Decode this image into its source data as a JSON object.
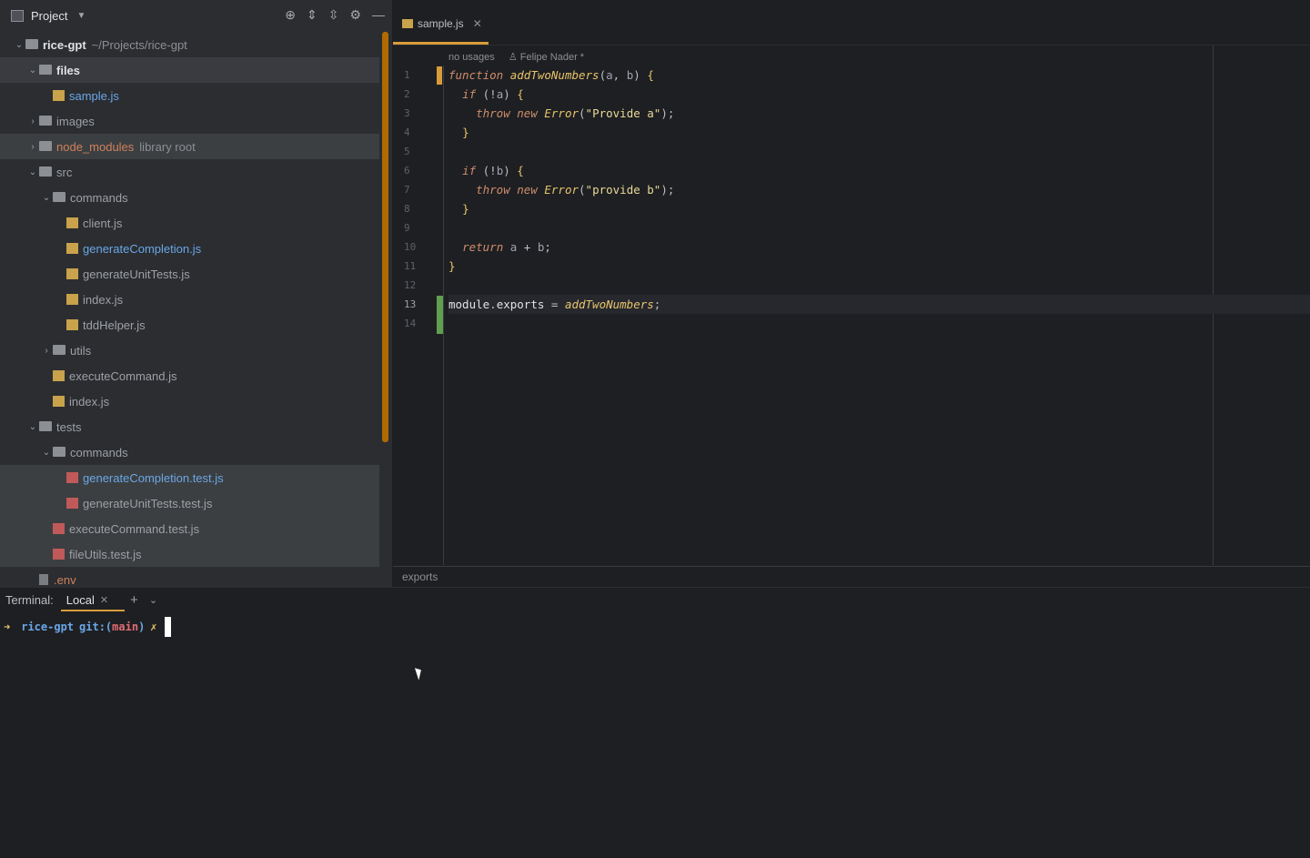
{
  "project_panel": {
    "title": "Project",
    "tree": [
      {
        "label": "rice-gpt",
        "extra": "~/Projects/rice-gpt",
        "type": "folder",
        "depth": 0,
        "open": true
      },
      {
        "label": "files",
        "type": "folder",
        "depth": 1,
        "open": true
      },
      {
        "label": "sample.js",
        "type": "js",
        "depth": 2
      },
      {
        "label": "images",
        "type": "folder",
        "depth": 1,
        "open": false
      },
      {
        "label": "node_modules",
        "extra": "library root",
        "type": "folder",
        "depth": 1,
        "open": false
      },
      {
        "label": "src",
        "type": "folder",
        "depth": 1,
        "open": true
      },
      {
        "label": "commands",
        "type": "folder",
        "depth": 2,
        "open": true
      },
      {
        "label": "client.js",
        "type": "js",
        "depth": 3
      },
      {
        "label": "generateCompletion.js",
        "type": "js",
        "depth": 3
      },
      {
        "label": "generateUnitTests.js",
        "type": "js",
        "depth": 3
      },
      {
        "label": "index.js",
        "type": "js",
        "depth": 3
      },
      {
        "label": "tddHelper.js",
        "type": "js",
        "depth": 3
      },
      {
        "label": "utils",
        "type": "folder",
        "depth": 2,
        "open": false
      },
      {
        "label": "executeCommand.js",
        "type": "js",
        "depth": 2
      },
      {
        "label": "index.js",
        "type": "js",
        "depth": 2
      },
      {
        "label": "tests",
        "type": "folder",
        "depth": 1,
        "open": true
      },
      {
        "label": "commands",
        "type": "folder",
        "depth": 2,
        "open": true
      },
      {
        "label": "generateCompletion.test.js",
        "type": "test",
        "depth": 3
      },
      {
        "label": "generateUnitTests.test.js",
        "type": "test",
        "depth": 3
      },
      {
        "label": "executeCommand.test.js",
        "type": "test",
        "depth": 2
      },
      {
        "label": "fileUtils.test.js",
        "type": "test",
        "depth": 2
      },
      {
        "label": ".env",
        "type": "env",
        "depth": 1
      }
    ]
  },
  "editor": {
    "tab_label": "sample.js",
    "inlay": {
      "usages": "no usages",
      "author": "Felipe Nader *"
    },
    "line_numbers": [
      "1",
      "2",
      "3",
      "4",
      "5",
      "6",
      "7",
      "8",
      "9",
      "10",
      "11",
      "12",
      "13",
      "14"
    ],
    "breadcrumb": "exports"
  },
  "terminal": {
    "title": "Terminal:",
    "tab_label": "Local",
    "prompt_arrow": "➜",
    "prompt_dir": "rice-gpt",
    "prompt_git": "git:(",
    "prompt_branch": "main",
    "prompt_git_close": ")",
    "prompt_dirty": "✗"
  },
  "icons": [
    "locate-icon",
    "expand-all-icon",
    "collapse-all-icon",
    "gear-icon",
    "minimize-icon",
    "close-icon",
    "add-icon",
    "chevron-down-icon"
  ]
}
